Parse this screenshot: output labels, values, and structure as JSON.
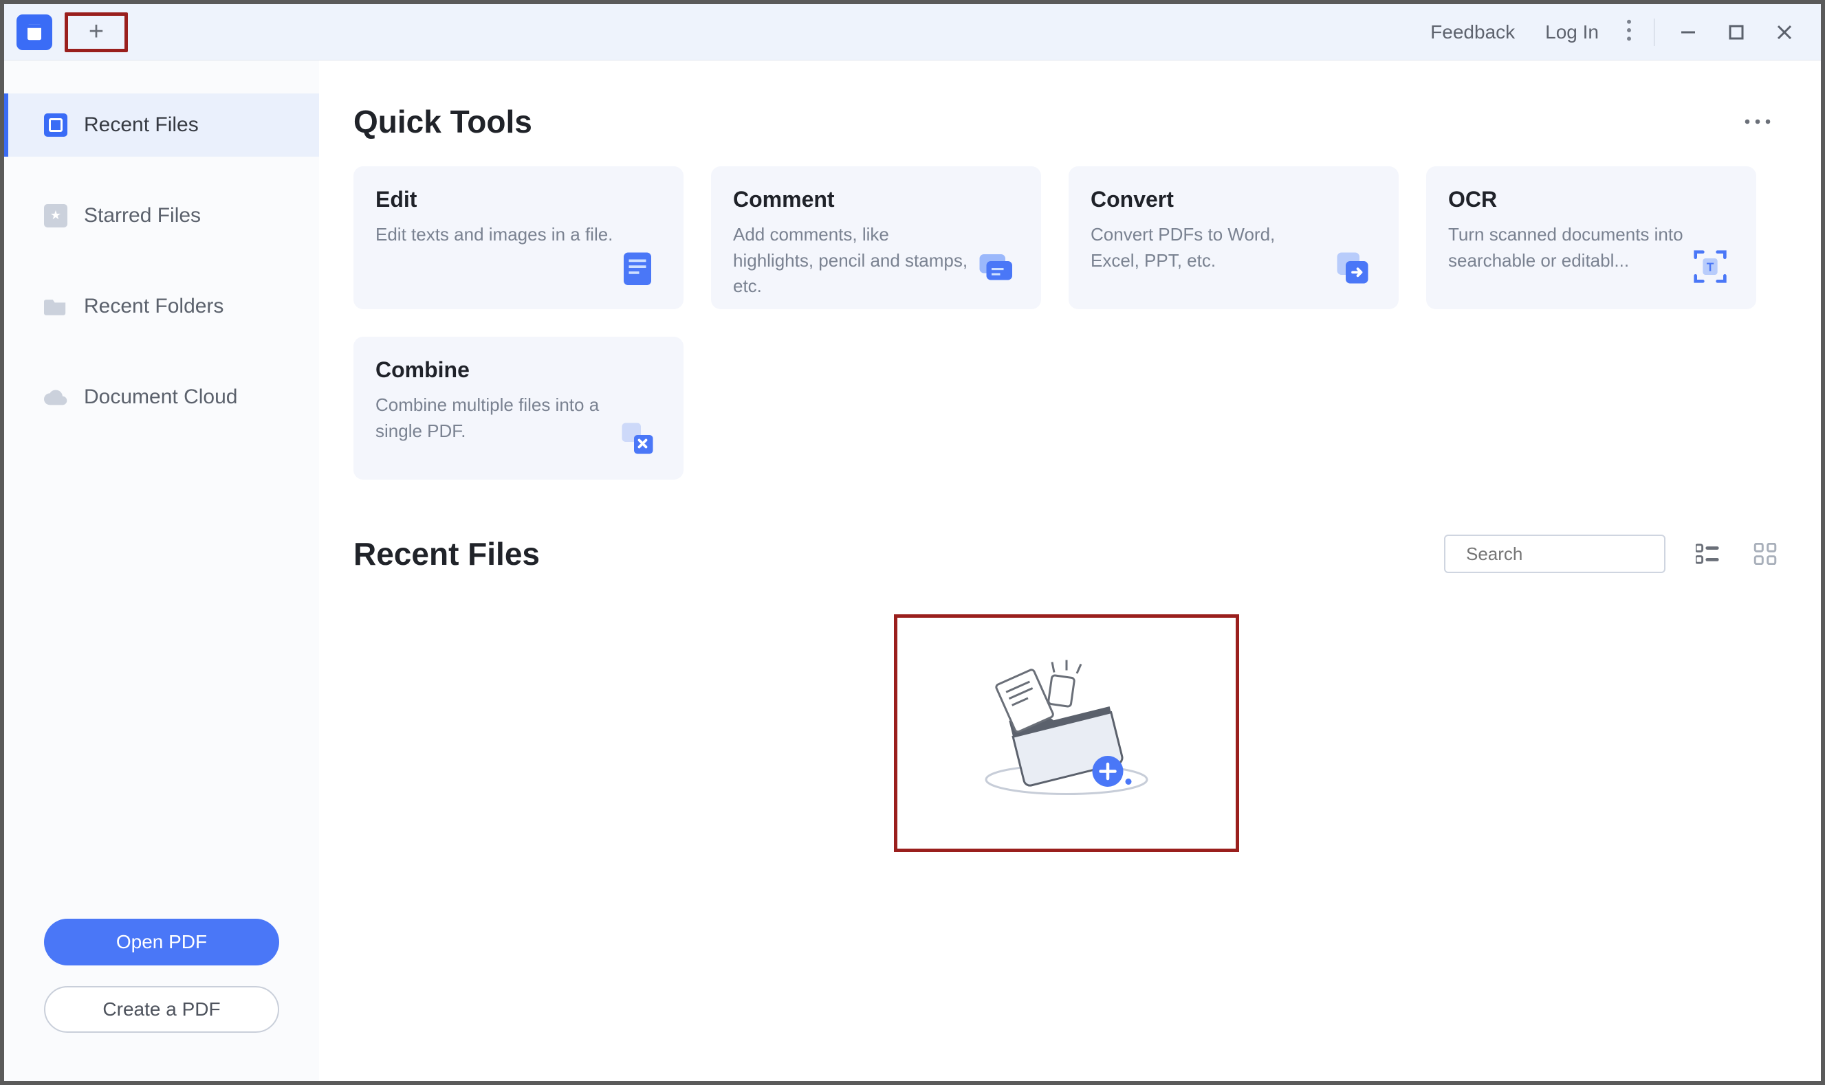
{
  "titlebar": {
    "feedback": "Feedback",
    "login": "Log In"
  },
  "sidebar": {
    "items": [
      {
        "label": "Recent Files"
      },
      {
        "label": "Starred Files"
      },
      {
        "label": "Recent Folders"
      },
      {
        "label": "Document Cloud"
      }
    ],
    "open_pdf": "Open PDF",
    "create_pdf": "Create a PDF"
  },
  "main": {
    "quick_tools_title": "Quick Tools",
    "tools": [
      {
        "title": "Edit",
        "desc": "Edit texts and images in a file."
      },
      {
        "title": "Comment",
        "desc": "Add comments, like highlights, pencil and stamps, etc."
      },
      {
        "title": "Convert",
        "desc": "Convert PDFs to Word, Excel, PPT, etc."
      },
      {
        "title": "OCR",
        "desc": "Turn scanned documents into searchable or editabl..."
      },
      {
        "title": "Combine",
        "desc": "Combine multiple files into a single PDF."
      }
    ],
    "recent_files_title": "Recent Files",
    "search_placeholder": "Search"
  }
}
